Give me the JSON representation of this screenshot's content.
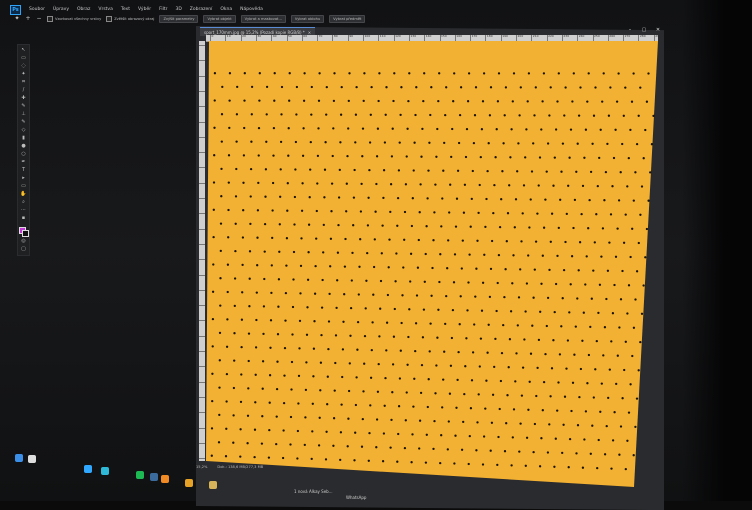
{
  "app": {
    "logo": "Ps",
    "menu": [
      "Soubor",
      "Úpravy",
      "Obraz",
      "Vrstva",
      "Text",
      "Výběr",
      "Filtr",
      "3D",
      "Zobrazení",
      "Okna",
      "Nápověda"
    ]
  },
  "options": {
    "sample_all_label": "Vzorkovat všechny vrstvy",
    "enhance_label": "Zvětšit obrazový okraj",
    "btn1": "Zvýšit parametry",
    "btn2": "Vybrat objekt",
    "btn3": "Vybrat a maskovat...",
    "btn4": "Vybrat oblohu",
    "btn5": "Vybrat předmět"
  },
  "document": {
    "tab_title": "sport_170mm.jpg @ 15,2% (Pozadí kopie RGB/8) *",
    "zoom": "15,2%",
    "doc_info": "Dok.: 138,6 MB/277,3 MB",
    "ruler_labels": [
      "0",
      "10",
      "20",
      "30",
      "40",
      "50",
      "60",
      "70",
      "80",
      "90",
      "100",
      "110",
      "120",
      "130",
      "140",
      "150",
      "160",
      "170",
      "180",
      "190",
      "200",
      "210",
      "220",
      "230",
      "240",
      "250",
      "260",
      "270",
      "280",
      "290"
    ],
    "canvas_color": "#f2b133",
    "dot_color": "#1a1206"
  },
  "taskbar": {
    "items": [
      {
        "name": "windows-start-icon",
        "color": "#3c8fe8"
      },
      {
        "name": "search-icon",
        "color": "#dddddd"
      },
      {
        "name": "chrome-icon",
        "color": "#e5a227"
      },
      {
        "name": "files-icon",
        "color": "#d7b45a"
      },
      {
        "name": "photoshop-icon",
        "color": "#31a8ff"
      },
      {
        "name": "edge-icon",
        "color": "#2fb9d8"
      },
      {
        "name": "spotify-icon",
        "color": "#1db954"
      },
      {
        "name": "steam-icon",
        "color": "#3b6b9c"
      },
      {
        "name": "vlc-icon",
        "color": "#f08a24"
      }
    ],
    "label1": "1 nová",
    "label2": "Alkay Seb...",
    "label3": "WhatsApp"
  }
}
